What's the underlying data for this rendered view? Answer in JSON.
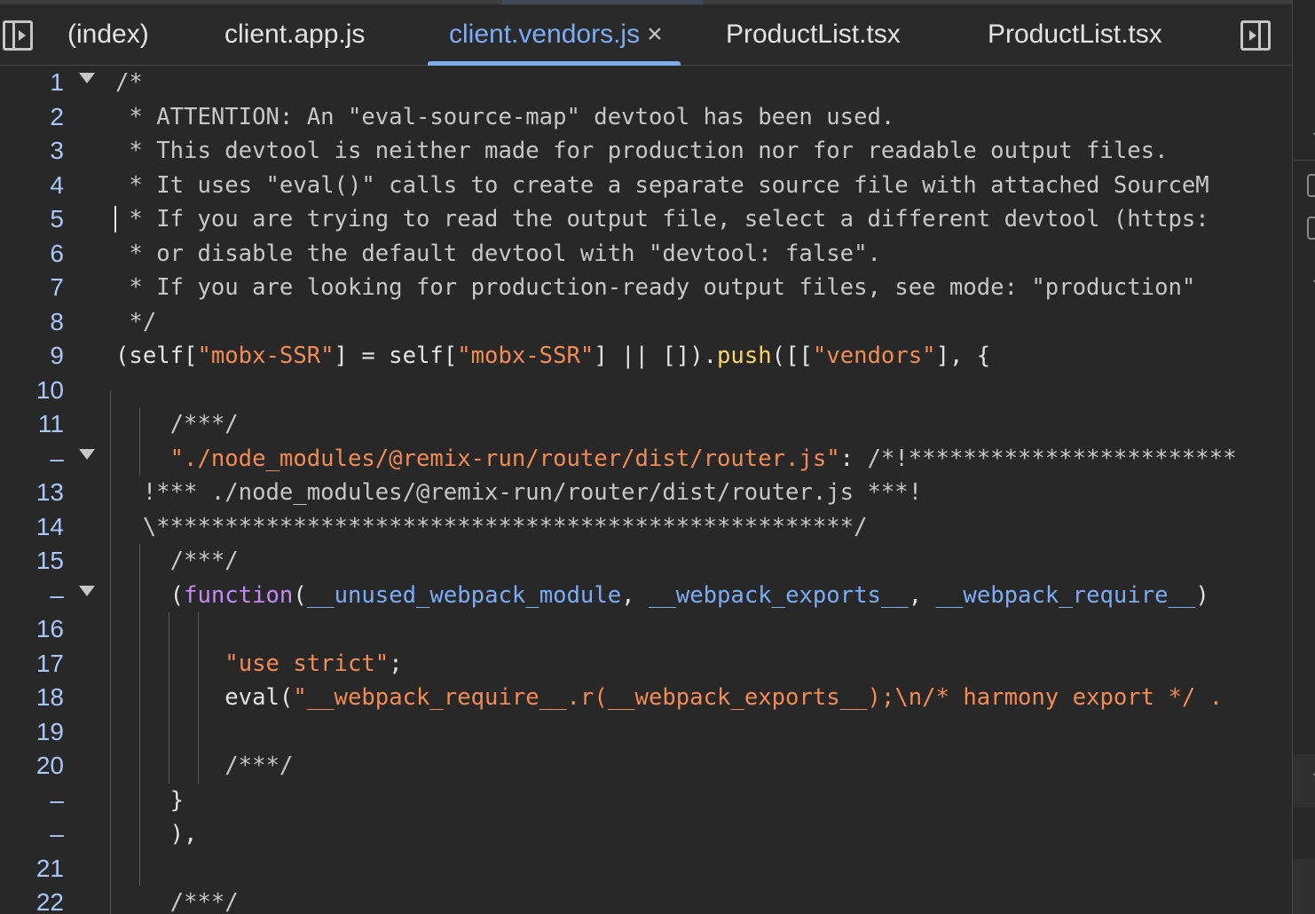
{
  "tabs": [
    {
      "label": "(index)",
      "active": false,
      "closable": false
    },
    {
      "label": "client.app.js",
      "active": false,
      "closable": false
    },
    {
      "label": "client.vendors.js",
      "active": true,
      "closable": true
    },
    {
      "label": "ProductList.tsx",
      "active": false,
      "closable": false
    },
    {
      "label": "ProductList.tsx",
      "active": false,
      "closable": false
    }
  ],
  "icons": {
    "left_toggle": "panel-left-toggle-icon",
    "right_toggle": "panel-right-toggle-icon",
    "close": "close-icon",
    "fold": "fold-arrow-icon"
  },
  "colors": {
    "background": "#282828",
    "line_number": "#a8c7fa",
    "active_tab": "#7cacf8",
    "string": "#f28b54",
    "comment": "#c7c7c7",
    "keyword": "#c58af9",
    "function_call": "#fdd663",
    "parameter": "#7cacf8"
  },
  "close_glyph": "×",
  "editor": {
    "lines": [
      {
        "number": "1",
        "fold": true,
        "tokens": [
          {
            "t": "/*",
            "c": "cmt"
          }
        ]
      },
      {
        "number": "2",
        "fold": false,
        "tokens": [
          {
            "t": " * ATTENTION: An \"eval-source-map\" devtool has been used.",
            "c": "cmt"
          }
        ]
      },
      {
        "number": "3",
        "fold": false,
        "tokens": [
          {
            "t": " * This devtool is neither made for production nor for readable output files.",
            "c": "cmt"
          }
        ]
      },
      {
        "number": "4",
        "fold": false,
        "tokens": [
          {
            "t": " * It uses \"eval()\" calls to create a separate source file with attached SourceM",
            "c": "cmt"
          }
        ]
      },
      {
        "number": "5",
        "fold": false,
        "tokens": [
          {
            "t": " * If you are trying to read the output file, select a different devtool (https:",
            "c": "cmt"
          }
        ]
      },
      {
        "number": "6",
        "fold": false,
        "tokens": [
          {
            "t": " * or disable the default devtool with \"devtool: false\".",
            "c": "cmt"
          }
        ]
      },
      {
        "number": "7",
        "fold": false,
        "tokens": [
          {
            "t": " * If you are looking for production-ready output files, see mode: \"production\"",
            "c": "cmt"
          }
        ]
      },
      {
        "number": "8",
        "fold": false,
        "tokens": [
          {
            "t": " */",
            "c": "cmt"
          }
        ]
      },
      {
        "number": "9",
        "fold": false,
        "tokens": [
          {
            "t": "(self[",
            "c": "plain"
          },
          {
            "t": "\"mobx-SSR\"",
            "c": "str"
          },
          {
            "t": "] = self[",
            "c": "plain"
          },
          {
            "t": "\"mobx-SSR\"",
            "c": "str"
          },
          {
            "t": "] || []).",
            "c": "plain"
          },
          {
            "t": "push",
            "c": "fn"
          },
          {
            "t": "([[",
            "c": "plain"
          },
          {
            "t": "\"vendors\"",
            "c": "str"
          },
          {
            "t": "], {",
            "c": "plain"
          }
        ]
      },
      {
        "number": "10",
        "fold": false,
        "tokens": []
      },
      {
        "number": "11",
        "fold": false,
        "tokens": [
          {
            "t": "    /***/",
            "c": "cmt"
          }
        ]
      },
      {
        "number": "–",
        "fold": true,
        "tokens": [
          {
            "t": "    \"./node_modules/@remix-run/router/dist/router.js\"",
            "c": "str"
          },
          {
            "t": ": ",
            "c": "plain"
          },
          {
            "t": "/*!************************",
            "c": "cmt"
          }
        ]
      },
      {
        "number": "13",
        "fold": false,
        "tokens": [
          {
            "t": "  !*** ./node_modules/@remix-run/router/dist/router.js ***!",
            "c": "cmt"
          }
        ]
      },
      {
        "number": "14",
        "fold": false,
        "tokens": [
          {
            "t": "  \\***************************************************/",
            "c": "cmt"
          }
        ]
      },
      {
        "number": "15",
        "fold": false,
        "tokens": [
          {
            "t": "    /***/",
            "c": "cmt"
          }
        ]
      },
      {
        "number": "–",
        "fold": true,
        "tokens": [
          {
            "t": "    (",
            "c": "plain"
          },
          {
            "t": "function",
            "c": "kw"
          },
          {
            "t": "(",
            "c": "plain"
          },
          {
            "t": "__unused_webpack_module",
            "c": "par"
          },
          {
            "t": ", ",
            "c": "plain"
          },
          {
            "t": "__webpack_exports__",
            "c": "par"
          },
          {
            "t": ", ",
            "c": "plain"
          },
          {
            "t": "__webpack_require__",
            "c": "par"
          },
          {
            "t": ")",
            "c": "plain"
          }
        ]
      },
      {
        "number": "16",
        "fold": false,
        "tokens": []
      },
      {
        "number": "17",
        "fold": false,
        "tokens": [
          {
            "t": "        ",
            "c": "plain"
          },
          {
            "t": "\"use strict\"",
            "c": "str"
          },
          {
            "t": ";",
            "c": "plain"
          }
        ]
      },
      {
        "number": "18",
        "fold": false,
        "tokens": [
          {
            "t": "        eval(",
            "c": "plain"
          },
          {
            "t": "\"__webpack_require__.r(__webpack_exports__);\\n/* harmony export */ .",
            "c": "str"
          }
        ]
      },
      {
        "number": "19",
        "fold": false,
        "tokens": []
      },
      {
        "number": "20",
        "fold": false,
        "tokens": [
          {
            "t": "        /***/",
            "c": "cmt"
          }
        ]
      },
      {
        "number": "–",
        "fold": false,
        "tokens": [
          {
            "t": "    }",
            "c": "plain"
          }
        ]
      },
      {
        "number": "–",
        "fold": false,
        "tokens": [
          {
            "t": "    ),",
            "c": "plain"
          }
        ]
      },
      {
        "number": "21",
        "fold": false,
        "tokens": []
      },
      {
        "number": "22",
        "fold": false,
        "tokens": [
          {
            "t": "    /***/",
            "c": "cmt"
          }
        ]
      }
    ]
  }
}
